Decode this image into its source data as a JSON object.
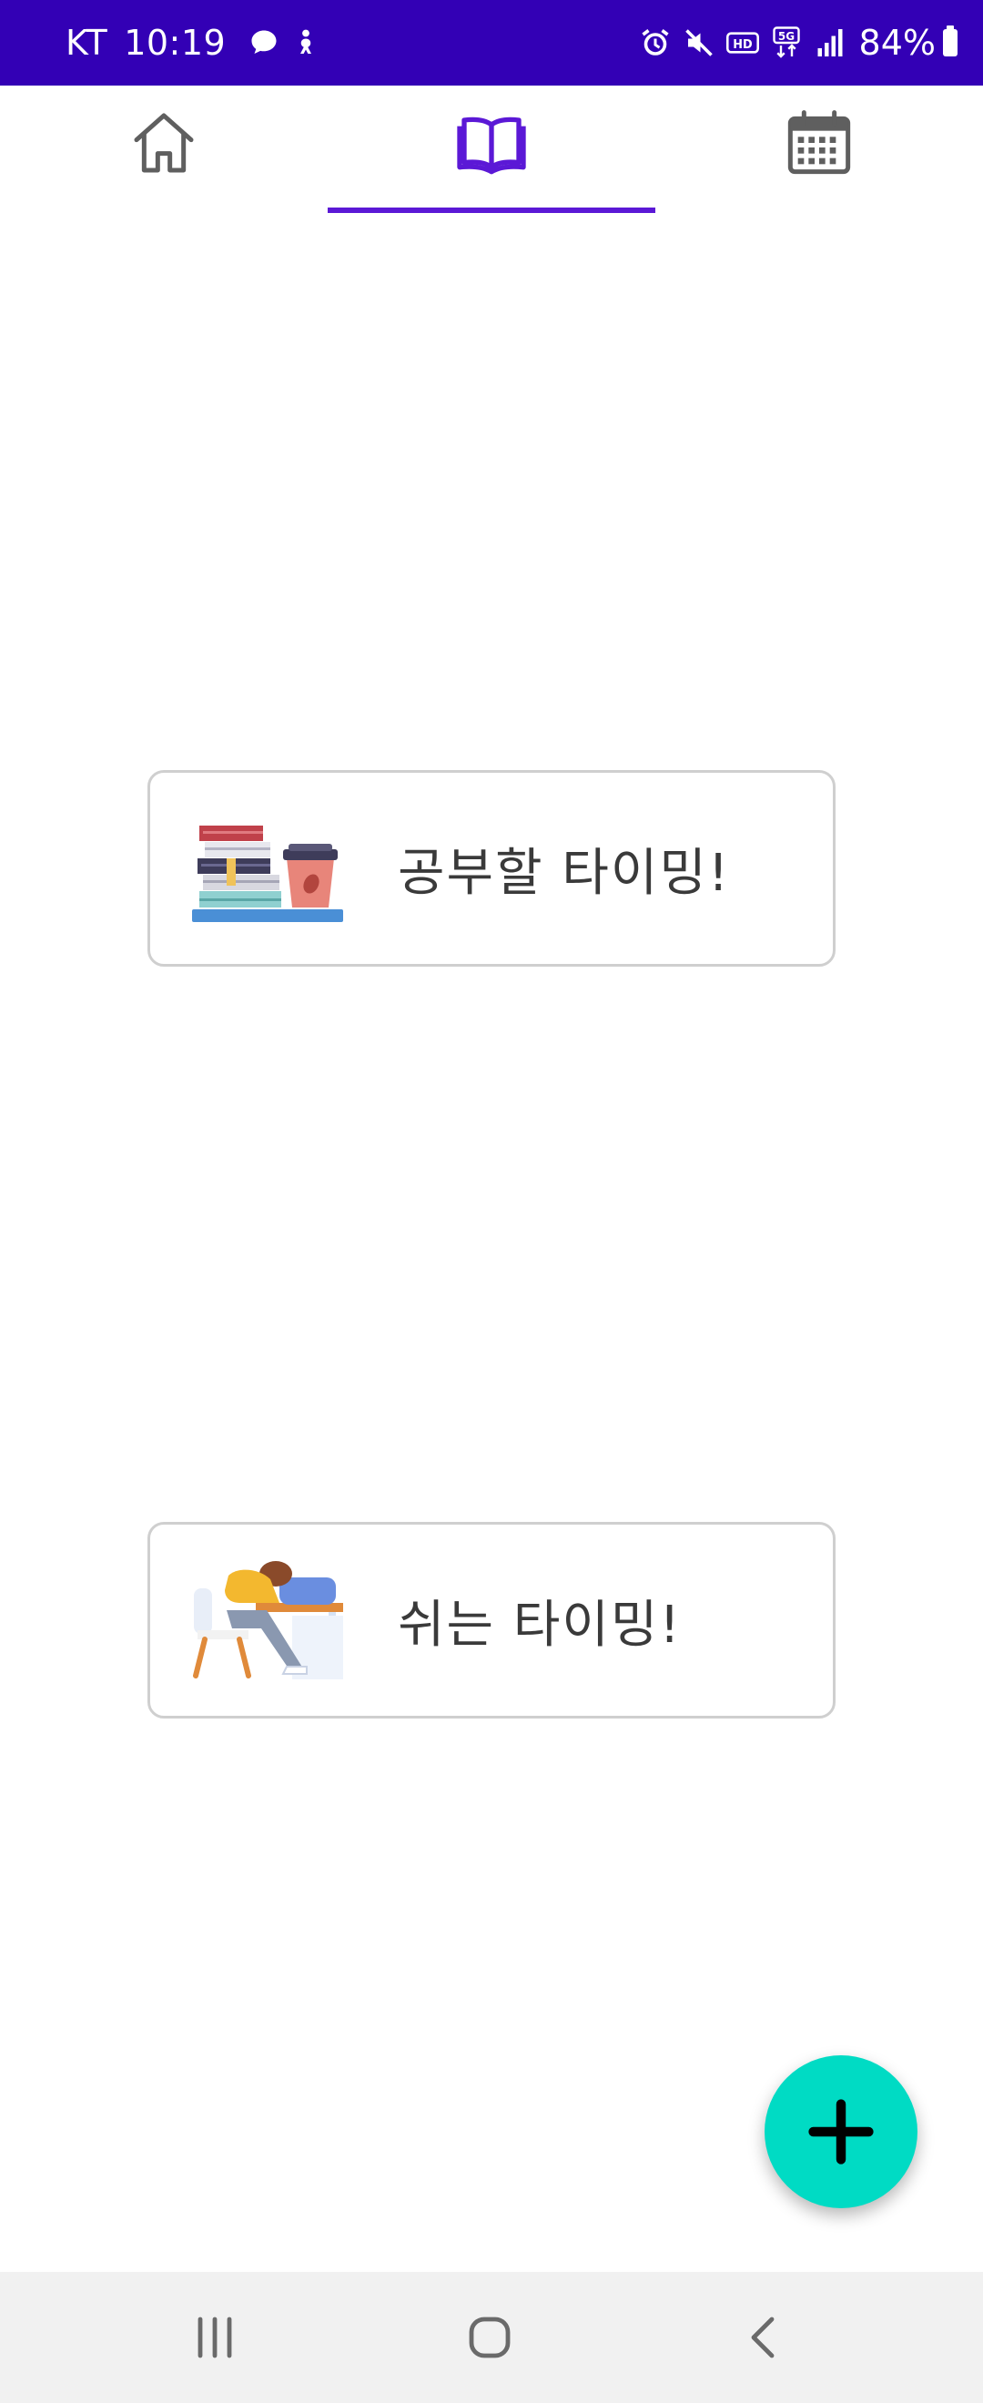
{
  "status_bar": {
    "carrier": "KT",
    "time": "10:19",
    "network": "5G",
    "battery_percent": "84%",
    "left_icons": [
      "chat-bubble-icon",
      "person-notification-icon"
    ],
    "right_icons": [
      "alarm-icon",
      "mute-icon",
      "hd-icon",
      "5g-icon",
      "signal-icon",
      "battery-icon"
    ],
    "background_color": "#3300b5"
  },
  "tabs": [
    {
      "icon": "home-icon",
      "selected": false
    },
    {
      "icon": "book-icon",
      "selected": true
    },
    {
      "icon": "calendar-icon",
      "selected": false
    }
  ],
  "accent_color": "#5b18d6",
  "cards": {
    "study": {
      "label": "공부할 타이밍!",
      "icon": "study-books-coffee-icon"
    },
    "rest": {
      "label": "쉬는 타이밍!",
      "icon": "resting-person-icon"
    }
  },
  "fab": {
    "icon": "plus-icon",
    "color": "#00dbc4"
  },
  "nav_bar": {
    "buttons": [
      "recent-apps-icon",
      "home-nav-icon",
      "back-icon"
    ]
  }
}
